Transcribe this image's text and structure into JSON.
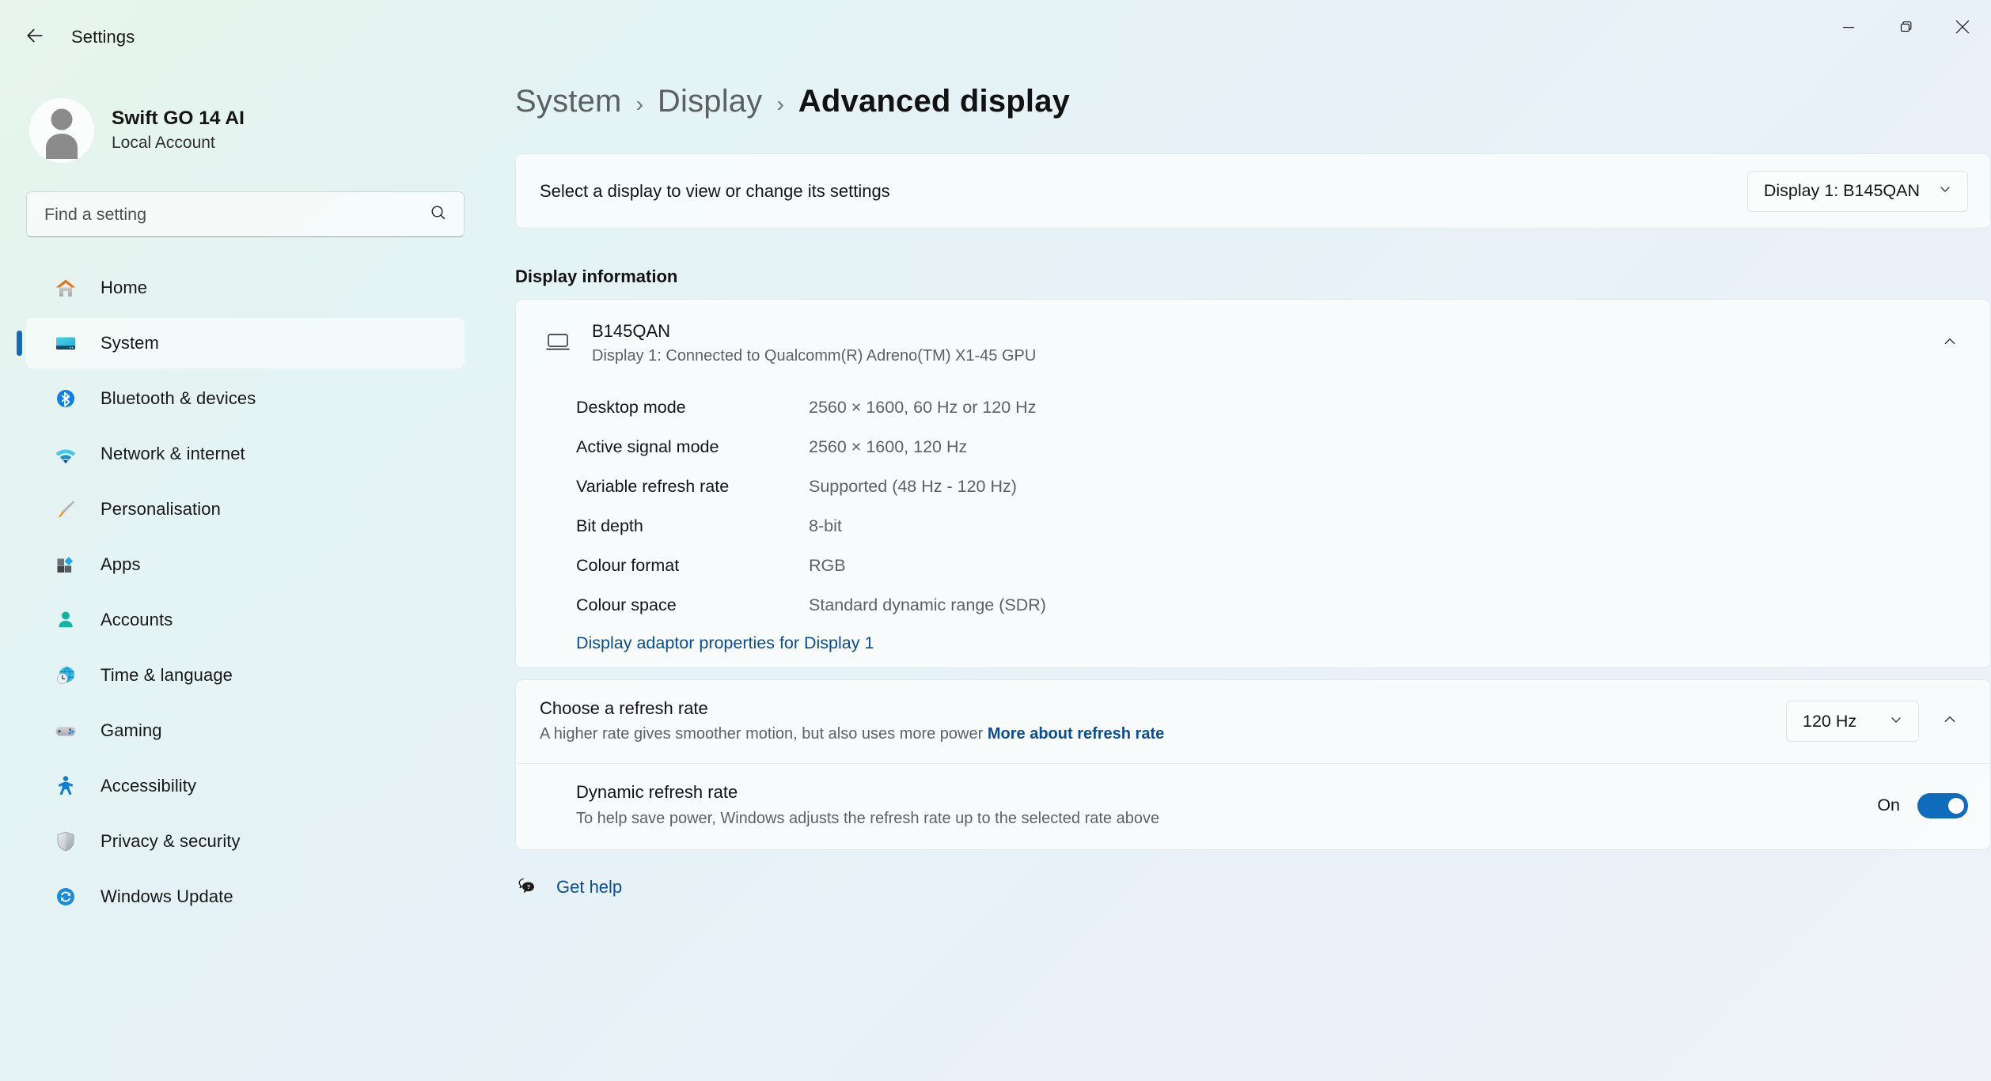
{
  "titlebar": {
    "app_title": "Settings",
    "back_icon": "back-arrow-icon",
    "minimize_icon": "minimize-icon",
    "restore_icon": "restore-icon",
    "close_icon": "close-icon"
  },
  "account": {
    "name": "Swift GO 14 AI",
    "type": "Local Account",
    "avatar_icon": "avatar-person-icon"
  },
  "search": {
    "placeholder": "Find a setting",
    "icon": "search-icon"
  },
  "sidebar": {
    "items": [
      {
        "label": "Home",
        "icon": "home-icon",
        "active": false
      },
      {
        "label": "System",
        "icon": "system-icon",
        "active": true
      },
      {
        "label": "Bluetooth & devices",
        "icon": "bluetooth-icon",
        "active": false
      },
      {
        "label": "Network & internet",
        "icon": "wifi-icon",
        "active": false
      },
      {
        "label": "Personalisation",
        "icon": "paintbrush-icon",
        "active": false
      },
      {
        "label": "Apps",
        "icon": "apps-icon",
        "active": false
      },
      {
        "label": "Accounts",
        "icon": "accounts-icon",
        "active": false
      },
      {
        "label": "Time & language",
        "icon": "time-language-icon",
        "active": false
      },
      {
        "label": "Gaming",
        "icon": "gamepad-icon",
        "active": false
      },
      {
        "label": "Accessibility",
        "icon": "accessibility-icon",
        "active": false
      },
      {
        "label": "Privacy & security",
        "icon": "shield-icon",
        "active": false
      },
      {
        "label": "Windows Update",
        "icon": "update-sync-icon",
        "active": false
      }
    ]
  },
  "breadcrumb": {
    "root": "System",
    "parent": "Display",
    "current": "Advanced display",
    "separator": "›"
  },
  "display_selector": {
    "label": "Select a display to view or change its settings",
    "value": "Display 1: B145QAN",
    "chevron_icon": "chevron-down-icon"
  },
  "display_information": {
    "section_title": "Display information",
    "monitor_icon": "monitor-icon",
    "name": "B145QAN",
    "connection": "Display 1: Connected to Qualcomm(R) Adreno(TM) X1-45 GPU",
    "collapse_icon": "chevron-up-icon",
    "specs": [
      {
        "key": "Desktop mode",
        "value": "2560 × 1600, 60 Hz or 120 Hz"
      },
      {
        "key": "Active signal mode",
        "value": "2560 × 1600, 120 Hz"
      },
      {
        "key": "Variable refresh rate",
        "value": "Supported (48 Hz - 120 Hz)"
      },
      {
        "key": "Bit depth",
        "value": "8-bit"
      },
      {
        "key": "Colour format",
        "value": "RGB"
      },
      {
        "key": "Colour space",
        "value": "Standard dynamic range (SDR)"
      }
    ],
    "adaptor_link": "Display adaptor properties for Display 1"
  },
  "refresh_rate": {
    "title": "Choose a refresh rate",
    "description": "A higher rate gives smoother motion, but also uses more power",
    "link": "More about refresh rate",
    "value": "120 Hz",
    "chevron_icon": "chevron-down-icon",
    "collapse_icon": "chevron-up-icon"
  },
  "dynamic_refresh_rate": {
    "title": "Dynamic refresh rate",
    "description": "To help save power, Windows adjusts the refresh rate up to the selected rate above",
    "state": "On",
    "enabled": true
  },
  "footer": {
    "get_help": "Get help",
    "icon": "help-question-icon"
  },
  "colors": {
    "accent": "#0f6cbd",
    "link": "#0a4d94",
    "title_text": "#121212",
    "muted_text": "#5d6164"
  }
}
